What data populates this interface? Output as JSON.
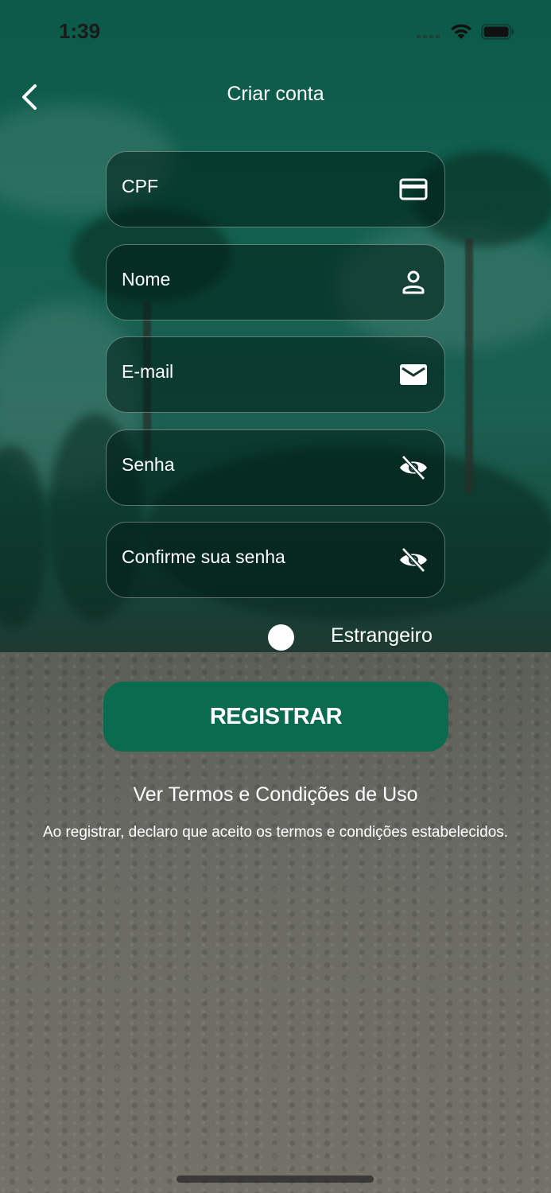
{
  "status_bar": {
    "time": "1:39"
  },
  "header": {
    "title": "Criar conta"
  },
  "form": {
    "fields": [
      {
        "label": "CPF",
        "icon": "card-icon"
      },
      {
        "label": "Nome",
        "icon": "person-icon"
      },
      {
        "label": "E-mail",
        "icon": "mail-icon"
      },
      {
        "label": "Senha",
        "icon": "eye-off-icon"
      },
      {
        "label": "Confirme sua senha",
        "icon": "eye-off-icon"
      }
    ],
    "foreigner_toggle": {
      "label": "Estrangeiro",
      "on": false
    },
    "register_label": "REGISTRAR"
  },
  "terms": {
    "link": "Ver Termos e Condições de Uso",
    "note": "Ao registrar, declaro que aceito os termos e condições estabelecidos."
  },
  "colors": {
    "accent": "#0b6b4f",
    "field_bg": "#001e16"
  }
}
